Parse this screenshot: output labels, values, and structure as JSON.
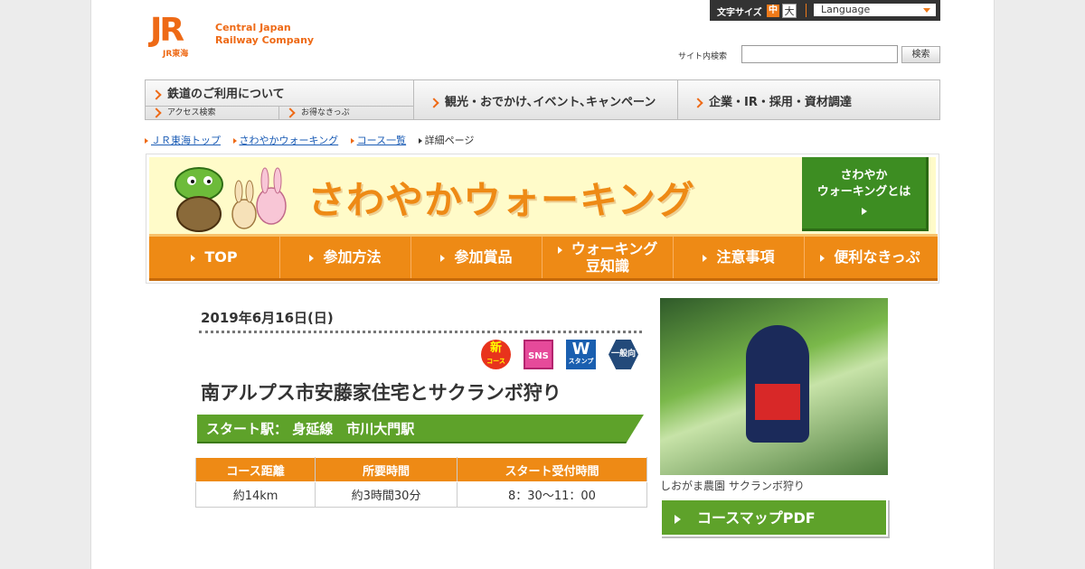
{
  "header": {
    "logo_mark": "JR",
    "logo_sub": "JR東海",
    "company_line1": "Central Japan",
    "company_line2": "Railway Company",
    "font_size_label": "文字サイズ",
    "font_size_mid": "中",
    "font_size_big": "大",
    "language": "Language",
    "search_label": "サイト内検索",
    "search_button": "検索"
  },
  "global_nav": {
    "item1": "鉄道のご利用について",
    "sub1": "アクセス検索",
    "sub2": "お得なきっぷ",
    "item2": "観光・おでかけ､イベント､キャンペーン",
    "item3": "企業・IR・採用・資材調達"
  },
  "breadcrumb": [
    "ＪＲ東海トップ",
    "さわやかウォーキング",
    "コース一覧",
    "詳細ページ"
  ],
  "banner": {
    "title": "さわやかウォーキング",
    "about_line1": "さわやか",
    "about_line2": "ウォーキングとは",
    "nav": [
      {
        "label": "TOP"
      },
      {
        "label": "参加方法"
      },
      {
        "label": "参加賞品"
      },
      {
        "label1": "ウォーキング",
        "label2": "豆知識"
      },
      {
        "label": "注意事項"
      },
      {
        "label": "便利なきっぷ"
      }
    ]
  },
  "course": {
    "date": "2019年6月16日(日)",
    "icons": {
      "new_label": "新",
      "new_sub": "コース",
      "sns": "SNS",
      "w": "W",
      "w_sub": "スタンプ",
      "general": "一般向"
    },
    "title": "南アルプス市安藤家住宅とサクランボ狩り",
    "start": "スタート駅：  身延線　市川大門駅",
    "table": {
      "headers": [
        "コース距離",
        "所要時間",
        "スタート受付時間"
      ],
      "values": [
        "約14km",
        "約3時間30分",
        "8：30～11：00"
      ]
    },
    "photo_caption": "しおがま農園 サクランボ狩り",
    "pdf_button": "コースマップPDF"
  }
}
